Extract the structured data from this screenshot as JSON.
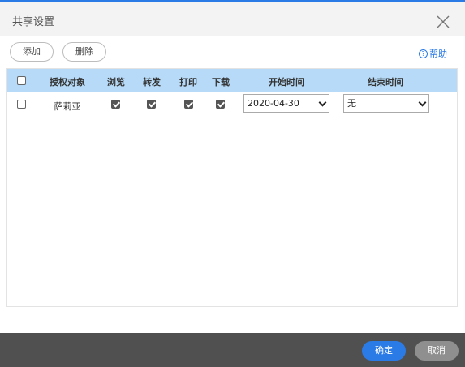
{
  "dialog": {
    "title": "共享设置",
    "help_label": "帮助"
  },
  "toolbar": {
    "add_label": "添加",
    "delete_label": "删除"
  },
  "table": {
    "columns": [
      "授权对象",
      "浏览",
      "转发",
      "打印",
      "下载",
      "开始时间",
      "结束时间"
    ],
    "select_all_checked": false,
    "rows": [
      {
        "selected": false,
        "object": "萨莉亚",
        "browse": true,
        "forward": true,
        "print": true,
        "download": true,
        "start_time": "2020-04-30",
        "end_time": "无"
      }
    ]
  },
  "footer": {
    "ok_label": "确定",
    "cancel_label": "取消"
  },
  "colors": {
    "accent": "#2b7be6",
    "header_row": "#b6daf7",
    "footer_bg": "#505050"
  }
}
